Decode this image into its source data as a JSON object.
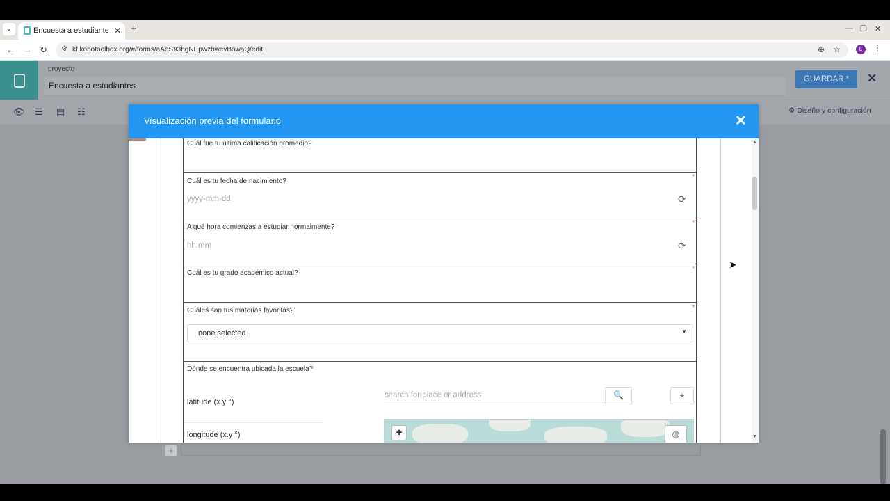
{
  "browser": {
    "tab_title": "Encuesta a estudiantes |",
    "tab_close": "✕",
    "new_tab": "+",
    "url": "kf.kobotoolbox.org/#/forms/aAeS93hgNEpwzbwevBowaQ/edit",
    "profile_initial": "L"
  },
  "app": {
    "project_label": "proyecto",
    "project_name": "Encuesta a estudiantes",
    "save_label": "GUARDAR *",
    "design_label": "Diseño y configuración",
    "close": "✕"
  },
  "modal": {
    "title": "Visualización previa del formulario",
    "close": "✕"
  },
  "form": {
    "questions": [
      {
        "label": "Cuál fue tu última calificación promedio?",
        "required": true
      },
      {
        "label": "Cuál es tu fecha de nacimiento?",
        "placeholder": "yyyy-mm-dd",
        "required": true
      },
      {
        "label": "A qué hora comienzas a estudiar normalmente?",
        "placeholder": "hh:mm",
        "required": true
      },
      {
        "label": "Cuál es tu grado académico actual?",
        "required": true
      },
      {
        "label": "Cuáles son tus materias favoritas?",
        "select_value": "none selected",
        "required": true
      },
      {
        "label": "Dónde se encuentra ubicada la escuela?",
        "required": false
      }
    ],
    "required_marker": "*",
    "geo": {
      "latitude_label": "latitude (x.y °)",
      "longitude_label": "longitude (x.y °)",
      "search_placeholder": "search for place or address",
      "zoom_in": "+"
    }
  },
  "icons": {
    "refresh": "refresh-icon",
    "search": "search-icon",
    "locate": "crosshair-icon",
    "globe": "globe-icon"
  },
  "colors": {
    "modal_header": "#2196f3",
    "save_button": "#3c78b6",
    "required": "#c0622b"
  }
}
